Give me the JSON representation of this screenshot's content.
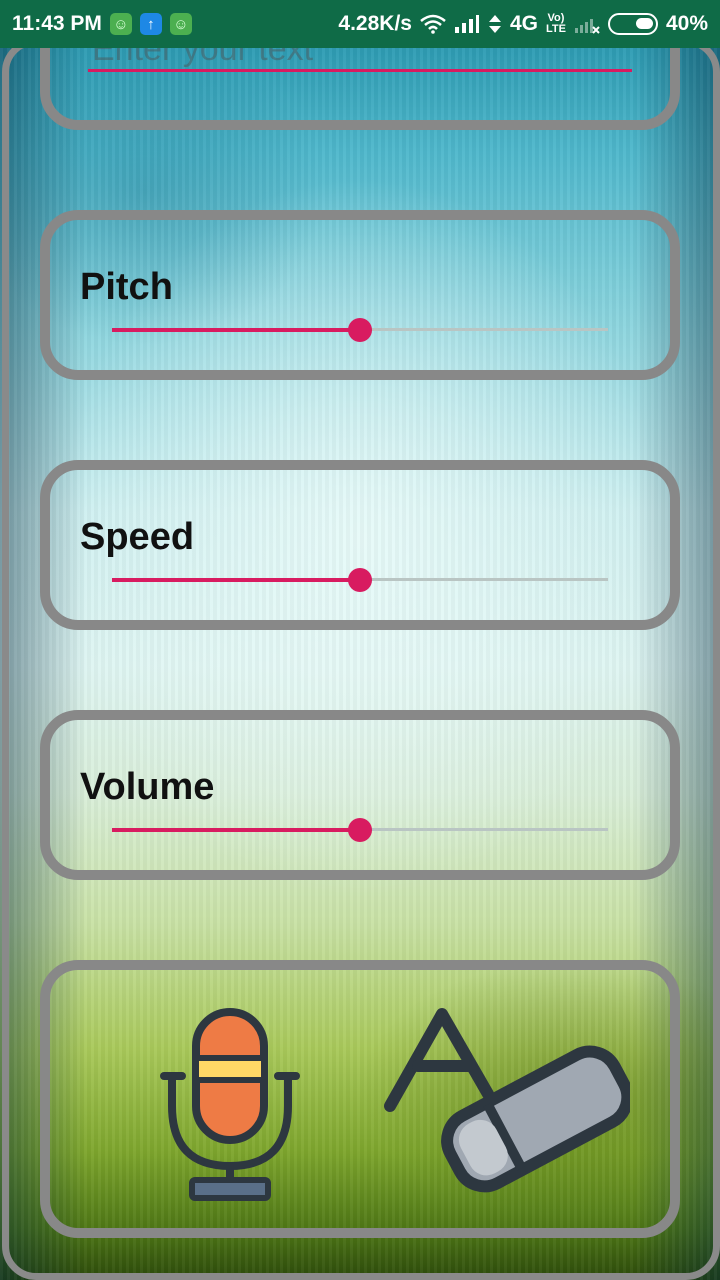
{
  "status_bar": {
    "time": "11:43 PM",
    "net_speed": "4.28K/s",
    "network_type": "4G",
    "volte_top": "Vo)",
    "volte_bottom": "LTE",
    "battery": "40%",
    "app_icons": [
      "green-frog-icon",
      "blue-upload-icon",
      "green-frog-icon"
    ]
  },
  "text_input": {
    "placeholder": "Enter your text",
    "value": ""
  },
  "pitch": {
    "label": "Pitch",
    "value": 0.5
  },
  "speed": {
    "label": "Speed",
    "value": 0.5
  },
  "volume": {
    "label": "Volume",
    "value": 0.5
  },
  "actions": {
    "speak_icon": "microphone-icon",
    "clear_icon": "eraser-text-icon"
  },
  "colors": {
    "status_bar": "#0f6b47",
    "accent": "#d81b60",
    "card_border": "#888888",
    "mic_body": "#ee7b45",
    "mic_band": "#ffd866",
    "icon_stroke": "#2d3740",
    "eraser_body": "#a0a8b2"
  }
}
